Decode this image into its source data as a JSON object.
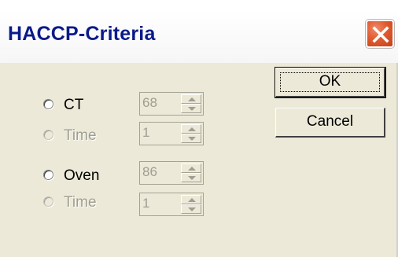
{
  "window": {
    "title": "HACCP-Criteria",
    "close_icon": "close-icon"
  },
  "options": [
    {
      "label": "CT",
      "enabled": true,
      "value": "68"
    },
    {
      "label": "Time",
      "enabled": false,
      "value": "1"
    },
    {
      "label": "Oven",
      "enabled": true,
      "value": "86"
    },
    {
      "label": "Time",
      "enabled": false,
      "value": "1"
    }
  ],
  "buttons": {
    "ok_label": "OK",
    "cancel_label": "Cancel"
  }
}
